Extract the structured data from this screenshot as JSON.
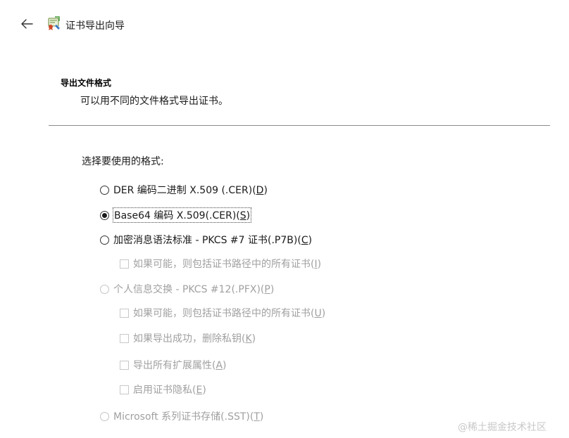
{
  "window": {
    "title": "证书导出向导",
    "back_icon": "back-arrow-icon",
    "wizard_icon": "certificate-wizard-icon"
  },
  "header": {
    "section_title": "导出文件格式",
    "section_description": "可以用不同的文件格式导出证书。"
  },
  "form": {
    "select_label": "选择要使用的格式:",
    "radios": [
      {
        "text": "DER 编码二进制 X.509 (.CER)(",
        "key": "D",
        "suffix": ")",
        "checked": false,
        "enabled": true
      },
      {
        "text": "Base64 编码 X.509(.CER)(",
        "key": "S",
        "suffix": ")",
        "checked": true,
        "enabled": true
      },
      {
        "text": "加密消息语法标准 - PKCS #7 证书(.P7B)(",
        "key": "C",
        "suffix": ")",
        "checked": false,
        "enabled": true
      },
      {
        "text": "个人信息交换 - PKCS #12(.PFX)(",
        "key": "P",
        "suffix": ")",
        "checked": false,
        "enabled": false
      },
      {
        "text": "Microsoft 系列证书存储(.SST)(",
        "key": "T",
        "suffix": ")",
        "checked": false,
        "enabled": false
      }
    ],
    "checkboxes": [
      {
        "text": "如果可能，则包括证书路径中的所有证书(",
        "key": "I",
        "suffix": ")",
        "checked": false,
        "enabled": false
      },
      {
        "text": "如果可能，则包括证书路径中的所有证书(",
        "key": "U",
        "suffix": ")",
        "checked": false,
        "enabled": false
      },
      {
        "text": "如果导出成功，删除私钥(",
        "key": "K",
        "suffix": ")",
        "checked": false,
        "enabled": false
      },
      {
        "text": "导出所有扩展属性(",
        "key": "A",
        "suffix": ")",
        "checked": false,
        "enabled": false
      },
      {
        "text": "启用证书隐私(",
        "key": "E",
        "suffix": ")",
        "checked": false,
        "enabled": false
      }
    ]
  },
  "watermark": "@稀土掘金技术社区"
}
